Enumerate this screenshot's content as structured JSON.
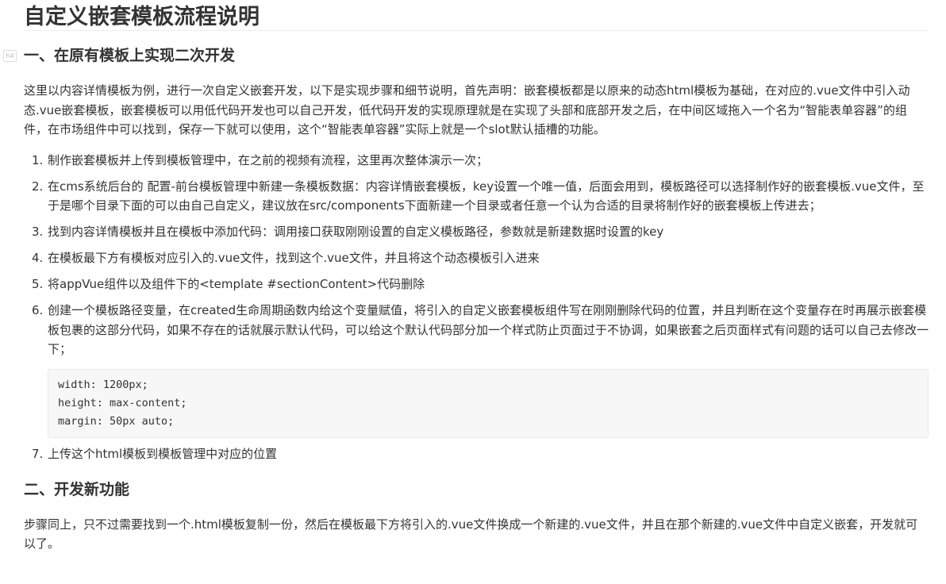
{
  "document": {
    "title": "自定义嵌套模板流程说明",
    "heading_badge": "h4",
    "section1": {
      "heading": "一、在原有模板上实现二次开发",
      "intro": "这里以内容详情模板为例，进行一次自定义嵌套开发，以下是实现步骤和细节说明，首先声明：嵌套模板都是以原来的动态html模板为基础，在对应的.vue文件中引入动态.vue嵌套模板，嵌套模板可以用低代码开发也可以自己开发，低代码开发的实现原理就是在实现了头部和底部开发之后，在中间区域拖入一个名为“智能表单容器”的组件，在市场组件中可以找到，保存一下就可以使用，这个“智能表单容器”实际上就是一个slot默认插槽的功能。",
      "steps": [
        {
          "num": "1.",
          "text": "制作嵌套模板并上传到模板管理中，在之前的视频有流程，这里再次整体演示一次；"
        },
        {
          "num": "2.",
          "text": "在cms系统后台的 配置-前台模板管理中新建一条模板数据：内容详情嵌套模板，key设置一个唯一值，后面会用到，模板路径可以选择制作好的嵌套模板.vue文件，至于是哪个目录下面的可以由自己自定义，建议放在src/components下面新建一个目录或者任意一个认为合适的目录将制作好的嵌套模板上传进去；"
        },
        {
          "num": "3.",
          "text": "找到内容详情模板并且在模板中添加代码：调用接口获取刚刚设置的自定义模板路径，参数就是新建数据时设置的key"
        },
        {
          "num": "4.",
          "text": "在模板最下方有模板对应引入的.vue文件，找到这个.vue文件，并且将这个动态模板引入进来"
        },
        {
          "num": "5.",
          "text": "将appVue组件以及组件下的<template #sectionContent>代码删除"
        },
        {
          "num": "6.",
          "text": "创建一个模板路径变量，在created生命周期函数内给这个变量赋值，将引入的自定义嵌套模板组件写在刚刚删除代码的位置，并且判断在这个变量存在时再展示嵌套模板包裹的这部分代码，如果不存在的话就展示默认代码，可以给这个默认代码部分加一个样式防止页面过于不协调，如果嵌套之后页面样式有问题的话可以自己去修改一下；"
        }
      ],
      "code_lines": [
        "width: 1200px;",
        "height: max-content;",
        "margin: 50px auto;"
      ],
      "step7": {
        "num": "7.",
        "text": "上传这个html模板到模板管理中对应的位置"
      }
    },
    "section2": {
      "heading": "二、开发新功能",
      "body": "步骤同上，只不过需要找到一个.html模板复制一份，然后在模板最下方将引入的.vue文件换成一个新建的.vue文件，并且在那个新建的.vue文件中自定义嵌套，开发就可以了。"
    }
  }
}
